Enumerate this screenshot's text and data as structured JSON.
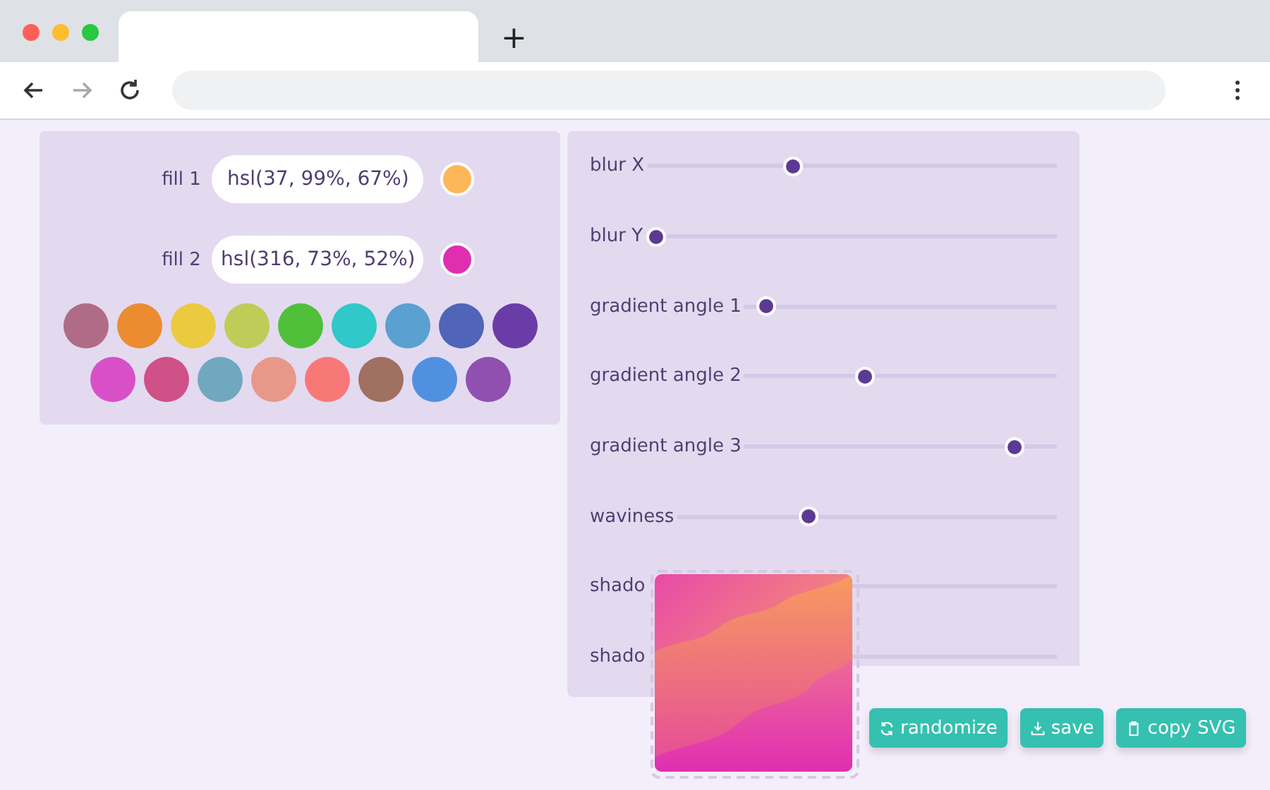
{
  "browser": {
    "new_tab": "+"
  },
  "fills": [
    {
      "label": "fill 1",
      "value": "hsl(37, 99%, 67%)",
      "color": "#fdb758"
    },
    {
      "label": "fill 2",
      "value": "hsl(316, 73%, 52%)",
      "color": "#e02eb1"
    }
  ],
  "presets": [
    [
      {
        "color": "#b06c84"
      },
      {
        "color": "#ec8c30"
      },
      {
        "color": "#ecca40"
      },
      {
        "color": "#c0cc58"
      },
      {
        "color": "#50c03a"
      },
      {
        "color": "#30c8c8"
      },
      {
        "color": "#5aa0d0"
      },
      {
        "color": "#5064b8"
      },
      {
        "color": "#6a3ca8"
      }
    ],
    [
      {
        "color": "#d850c8"
      },
      {
        "color": "#d05088"
      },
      {
        "color": "#70a8c0"
      },
      {
        "color": "#e89888"
      },
      {
        "color": "#f87878"
      },
      {
        "color": "#a07060"
      },
      {
        "color": "#5090e0"
      },
      {
        "color": "#9050b0"
      }
    ]
  ],
  "sliders": [
    {
      "label": "blur X",
      "level": 0.35
    },
    {
      "label": "blur Y",
      "level": 0
    },
    {
      "label": "gradient angle 1",
      "level": 0.04
    },
    {
      "label": "gradient angle 2",
      "level": 0.38
    },
    {
      "label": "gradient angle 3",
      "level": 0.89
    },
    {
      "label": "waviness",
      "level": 0.34
    },
    {
      "label": "shado"
    },
    {
      "label": "shado"
    }
  ],
  "preview": {
    "kind": "picture"
  },
  "actions": [
    {
      "label": "randomize"
    },
    {
      "label": "save"
    },
    {
      "label": "copy SVG"
    }
  ]
}
